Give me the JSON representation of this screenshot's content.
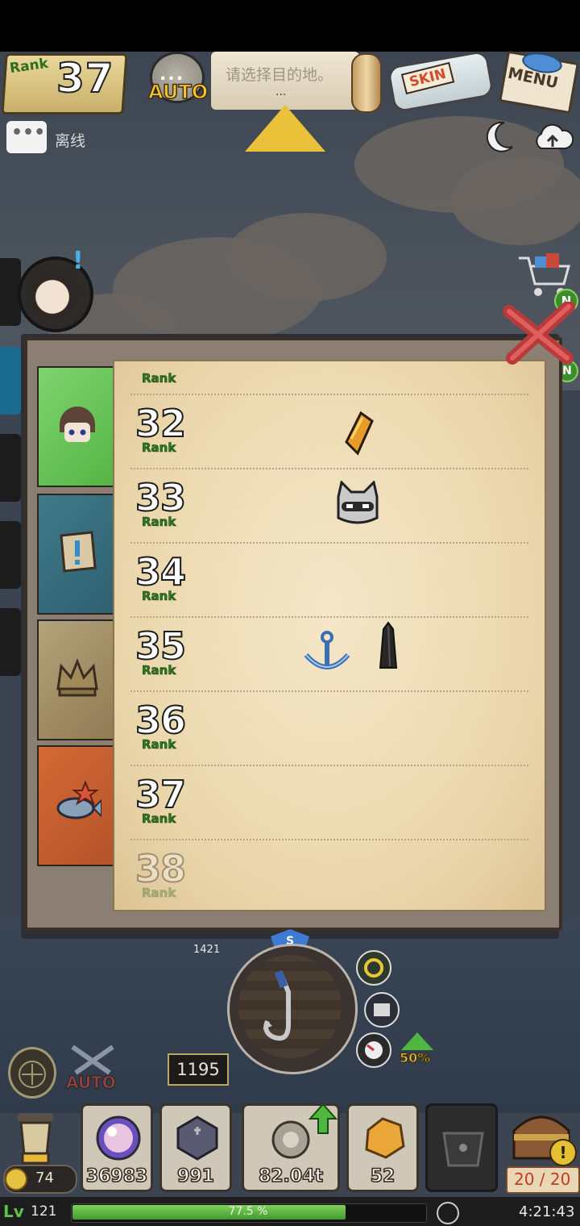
{
  "header": {
    "rank_label": "Rank",
    "rank_value": "37",
    "auto_label": "AUTO",
    "auto_dots": "...",
    "destination_text": "请选择目的地。",
    "destination_dots": "...",
    "skin_label": "SKIN",
    "menu_label": "MENU"
  },
  "chat": {
    "status_label": "离线"
  },
  "icons": {
    "top": [
      "auto-icon",
      "map-scroll-icon",
      "skin-bottle-icon",
      "menu-book-icon",
      "moon-icon",
      "cloud-upload-icon",
      "chat-icon",
      "up-arrow-icon"
    ],
    "side": [
      "avatar-icon",
      "shop-cart-icon",
      "close-icon"
    ]
  },
  "badges": {
    "new_1": "N",
    "new_2": "N",
    "alert": "!"
  },
  "panel": {
    "tabs": [
      {
        "name": "profile",
        "icon": "character-face-icon"
      },
      {
        "name": "quest",
        "icon": "quest-scroll-icon"
      },
      {
        "name": "rank",
        "icon": "crown-icon"
      },
      {
        "name": "fish",
        "icon": "fish-starfish-icon"
      }
    ],
    "rank_tag": "Rank",
    "rows": [
      {
        "num": "32",
        "rewards": [
          "amber-crystal-icon"
        ]
      },
      {
        "num": "33",
        "rewards": [
          "cat-mask-icon"
        ]
      },
      {
        "num": "34",
        "rewards": []
      },
      {
        "num": "35",
        "rewards": [
          "anchor-icon",
          "obelisk-icon"
        ]
      },
      {
        "num": "36",
        "rewards": []
      },
      {
        "num": "37",
        "rewards": []
      },
      {
        "num": "38",
        "rewards": []
      }
    ]
  },
  "hud": {
    "target_depth": "1421",
    "current_depth": "1195",
    "dial_badge": "S",
    "speed_boost": "50%",
    "auto_label": "AUTO",
    "coins": "74",
    "inventory": [
      {
        "icon": "pearl-orb-icon",
        "value": "36983"
      },
      {
        "icon": "dark-gem-icon",
        "value": "991"
      },
      {
        "icon": "gear-shell-icon",
        "value": "82.04t"
      },
      {
        "icon": "amber-chunk-icon",
        "value": "52"
      },
      {
        "icon": "locked-slot-icon",
        "value": ""
      }
    ],
    "capacity": "20 / 20"
  },
  "footer": {
    "level_icon": "Lv",
    "level": "121",
    "xp_fraction": 0.775,
    "xp_text": "77.5 %",
    "time": "4:21:43"
  },
  "colors": {
    "accent_gold": "#e9c23a",
    "rank_green": "#2f7a22",
    "xp_green": "#5ec04a",
    "alert_blue": "#4ab0e8",
    "capacity_red": "#c23a28"
  }
}
